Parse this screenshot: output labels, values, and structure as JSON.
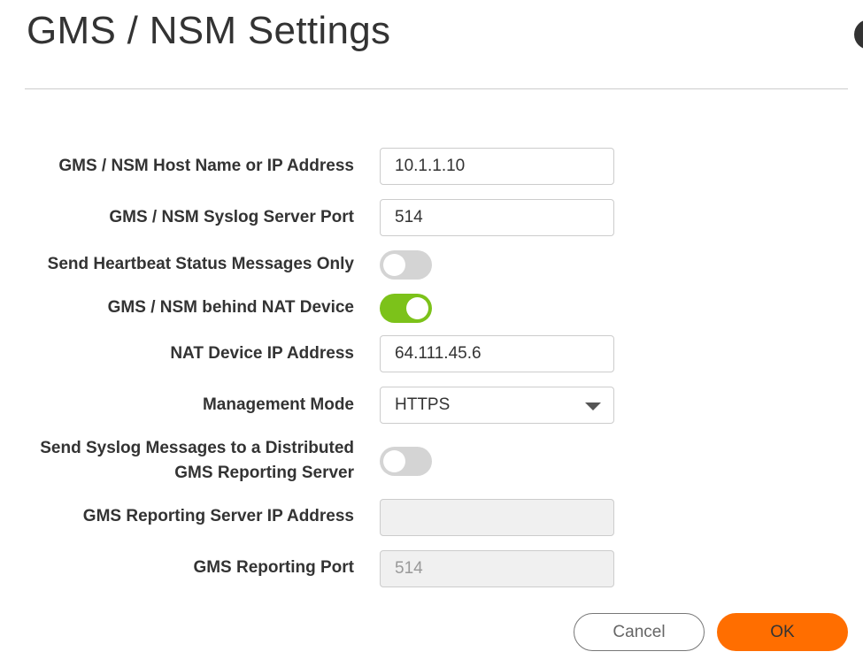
{
  "dialog": {
    "title": "GMS / NSM Settings"
  },
  "form": {
    "host_label": "GMS / NSM Host Name or IP Address",
    "host_value": "10.1.1.10",
    "syslog_port_label": "GMS / NSM Syslog Server Port",
    "syslog_port_value": "514",
    "heartbeat_label": "Send Heartbeat Status Messages Only",
    "heartbeat_on": false,
    "behind_nat_label": "GMS / NSM behind NAT Device",
    "behind_nat_on": true,
    "nat_ip_label": "NAT Device IP Address",
    "nat_ip_value": "64.111.45.6",
    "mode_label": "Management Mode",
    "mode_value": "HTTPS",
    "distributed_label_line1": "Send Syslog Messages to a Distributed",
    "distributed_label_line2": "GMS Reporting Server",
    "distributed_on": false,
    "reporting_ip_label": "GMS Reporting Server IP Address",
    "reporting_ip_value": "",
    "reporting_port_label": "GMS Reporting Port",
    "reporting_port_value": "514"
  },
  "buttons": {
    "cancel_label": "Cancel",
    "ok_label": "OK"
  },
  "colors": {
    "accent": "#ff6e00",
    "toggle_on": "#7cc21a",
    "toggle_off": "#d4d4d4"
  },
  "icons": {
    "close": "close-icon",
    "dropdown": "chevron-down-icon"
  }
}
